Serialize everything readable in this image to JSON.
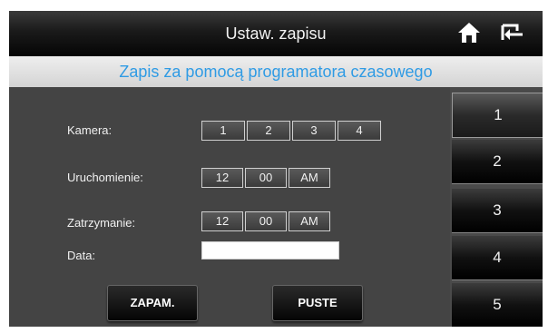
{
  "header": {
    "title": "Ustaw. zapisu",
    "icons": [
      "home-icon",
      "back-icon"
    ]
  },
  "subtitle": "Zapis za pomocą programatora czasowego",
  "form": {
    "camera": {
      "label": "Kamera:",
      "options": [
        "1",
        "2",
        "3",
        "4"
      ]
    },
    "start": {
      "label": "Uruchomienie:",
      "hour": "12",
      "minute": "00",
      "period": "AM"
    },
    "stop": {
      "label": "Zatrzymanie:",
      "hour": "12",
      "minute": "00",
      "period": "AM"
    },
    "date": {
      "label": "Data:",
      "value": ""
    }
  },
  "buttons": {
    "save": "ZAPAM.",
    "clear": "PUSTE"
  },
  "sidebar": {
    "items": [
      "1",
      "2",
      "3",
      "4",
      "5"
    ]
  },
  "colors": {
    "accent": "#2f9be4",
    "panel": "#444444",
    "titlebar": "#0a0a0a"
  }
}
